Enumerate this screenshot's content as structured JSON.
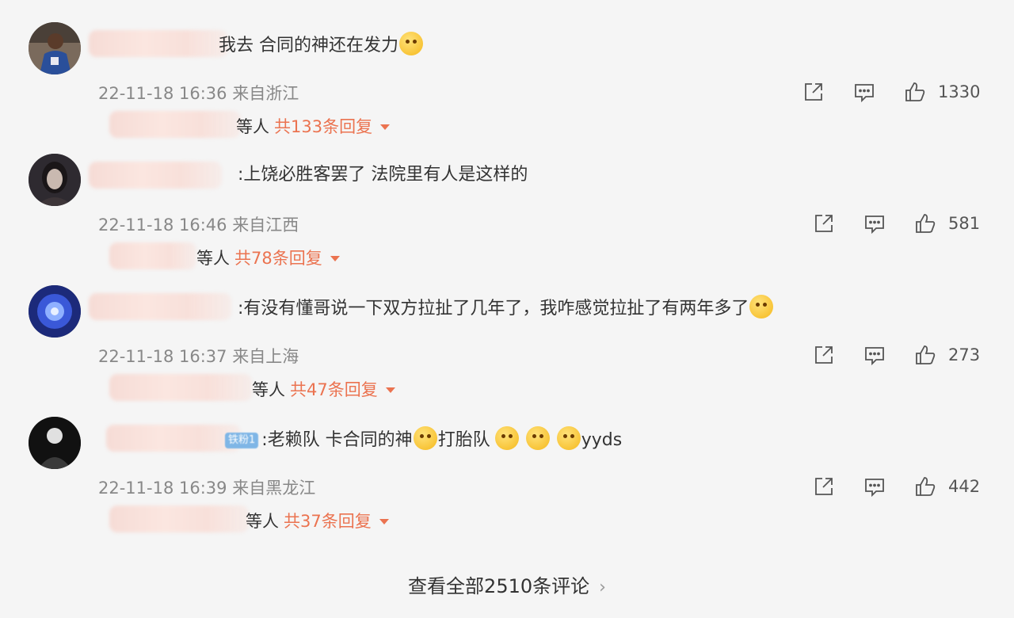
{
  "comments": [
    {
      "text": "我去 合同的神还在发力",
      "emoji": "smirk-emoji",
      "date": "22-11-18 16:36",
      "location": "来自浙江",
      "likes": "1330",
      "reply_who": "等人",
      "reply_count": "共133条回复"
    },
    {
      "text": ":上饶必胜客罢了 法院里有人是这样的",
      "date": "22-11-18 16:46",
      "location": "来自江西",
      "likes": "581",
      "reply_who": "等人",
      "reply_count": "共78条回复"
    },
    {
      "text": ":有没有懂哥说一下双方拉扯了几年了，我咋感觉拉扯了有两年多了",
      "emoji": "laugh-cry-emoji",
      "date": "22-11-18 16:37",
      "location": "来自上海",
      "likes": "273",
      "reply_who": "等人",
      "reply_count": "共47条回复"
    },
    {
      "badge": "铁粉1",
      "text_a": ":老赖队 卡合同的神",
      "text_b": "打胎队",
      "text_c": "yyds",
      "emoji": "party-face-emoji",
      "date": "22-11-18 16:39",
      "location": "来自黑龙江",
      "likes": "442",
      "reply_who": "等人",
      "reply_count": "共37条回复"
    }
  ],
  "footer": {
    "view_all": "查看全部2510条评论",
    "chevron": "›"
  },
  "colors": {
    "background": "#f5f5f5",
    "accent": "#eb7350",
    "meta": "#888888"
  }
}
